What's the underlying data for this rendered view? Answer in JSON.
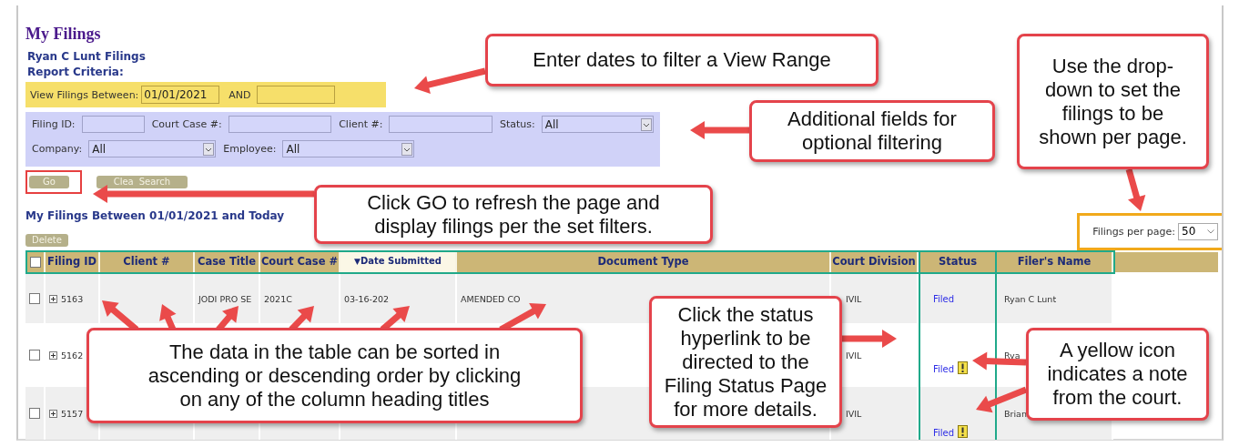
{
  "page_title": "My Filings",
  "owner_heading": "Ryan C Lunt Filings",
  "criteria_heading": "Report Criteria:",
  "view_range": {
    "label": "View Filings Between:",
    "from_value": "01/01/2021",
    "and_label": "AND"
  },
  "filter_rows": [
    [
      {
        "kind": "text",
        "label": "Filing ID:"
      },
      {
        "kind": "text",
        "label": "Court Case #:"
      },
      {
        "kind": "text",
        "label": "Client #:"
      },
      {
        "kind": "select",
        "label": "Status:",
        "value": "All"
      }
    ],
    [
      {
        "kind": "select",
        "label": "Company:",
        "value": "All"
      },
      {
        "kind": "select",
        "label": "Employee:",
        "value": "All"
      }
    ]
  ],
  "buttons": [
    {
      "label": "Go",
      "highlighted": true
    },
    {
      "label": "Clea",
      "label_2": "Search",
      "highlighted": false
    }
  ],
  "results_heading": "My Filings Between 01/01/2021 and Today",
  "delete_button": "Delete",
  "per_page": {
    "label": "Filings per page:",
    "value": "50"
  },
  "table": {
    "all_checked": false,
    "columns": [
      {
        "label": "Filing ID",
        "selected": false
      },
      {
        "label": "Client #",
        "selected": false
      },
      {
        "label": "Case Title",
        "selected": false
      },
      {
        "label": "Court Case #",
        "selected": false
      },
      {
        "label": "Date Submitted",
        "selected": true,
        "sort_icon": "▼"
      },
      {
        "label": "Document Type",
        "selected": false
      },
      {
        "label": "Court Division",
        "selected": false
      },
      {
        "label": "Status",
        "selected": false
      },
      {
        "label": "Filer's Name",
        "selected": false
      }
    ],
    "rows": [
      {
        "checked": false,
        "filing_id": "5163",
        "case_title": "JODI PRO SE",
        "court_case": "2021C",
        "date": "03-16-202",
        "document_type": "AMENDED CO",
        "division": "IVIL",
        "status": "Filed",
        "court_note": false,
        "filer": "Ryan C Lunt"
      },
      {
        "checked": false,
        "filing_id": "5162",
        "division": "IVIL",
        "status": "Filed",
        "court_note": true,
        "filer": "Rya"
      },
      {
        "checked": false,
        "filing_id": "5157",
        "division": "IVIL",
        "status": "Filed",
        "court_note": true,
        "filer": "Brian"
      }
    ]
  },
  "callouts": [
    {
      "text": "Enter dates to filter a View Range"
    },
    {
      "text": "Additional fields for\noptional filtering"
    },
    {
      "text": "Use the drop-\ndown to set the\nfilings to be\nshown per page."
    },
    {
      "text": "Click GO to refresh the page and\ndisplay filings per the set filters."
    },
    {
      "text": "The data in the table can be sorted in\nascending or descending order by clicking\non any of the column heading titles"
    },
    {
      "text": "Click the status\nhyperlink to be\ndirected to the\nFiling Status Page\nfor more details."
    },
    {
      "text": "A yellow icon\nindicates a note\nfrom the court."
    }
  ]
}
